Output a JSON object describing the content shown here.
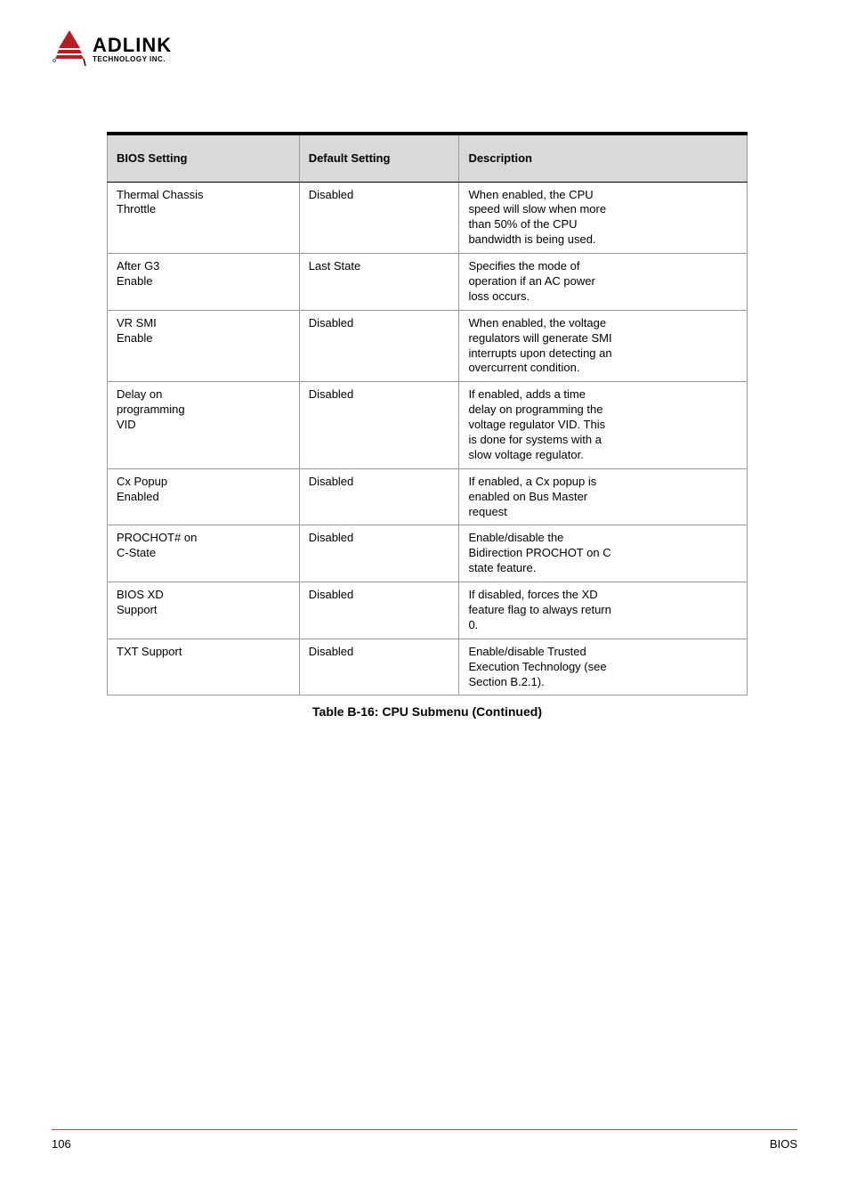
{
  "logo": {
    "main": "ADLINK",
    "sub": "TECHNOLOGY INC."
  },
  "table": {
    "headers": [
      "BIOS Setting",
      "Default Setting",
      "Description"
    ],
    "rows": [
      [
        "Thermal Chassis<br>Throttle",
        "Disabled",
        "When enabled, the CPU<br>speed will slow when more<br>than 50% of the CPU<br>bandwidth is being used."
      ],
      [
        "After G3<br>Enable",
        "Last State",
        "Specifies the mode of<br>operation if an AC power<br>loss occurs."
      ],
      [
        "VR SMI<br>Enable",
        "Disabled",
        "When enabled, the voltage<br>regulators will generate SMI<br>interrupts upon detecting an<br>overcurrent condition."
      ],
      [
        "Delay on<br>programming<br>VID",
        "Disabled",
        "If enabled, adds a time<br>delay on programming the<br>voltage regulator VID. This<br>is done for systems with a<br>slow voltage regulator."
      ],
      [
        "Cx Popup<br>Enabled",
        "Disabled",
        "If enabled, a Cx popup is<br>enabled on Bus Master<br>request"
      ],
      [
        "PROCHOT# on<br>C-State",
        "Disabled",
        "Enable/disable the<br>Bidirection PROCHOT on C<br>state feature."
      ],
      [
        "BIOS XD<br>Support",
        "Disabled",
        "If disabled, forces the XD<br>feature flag to always return<br>0."
      ],
      [
        "TXT Support",
        "Disabled",
        "Enable/disable Trusted<br>Execution Technology (see<br>Section B.2.1)."
      ]
    ],
    "caption": "Table B-16: CPU Submenu (Continued)"
  },
  "footer": {
    "left": "106",
    "right": "BIOS"
  }
}
